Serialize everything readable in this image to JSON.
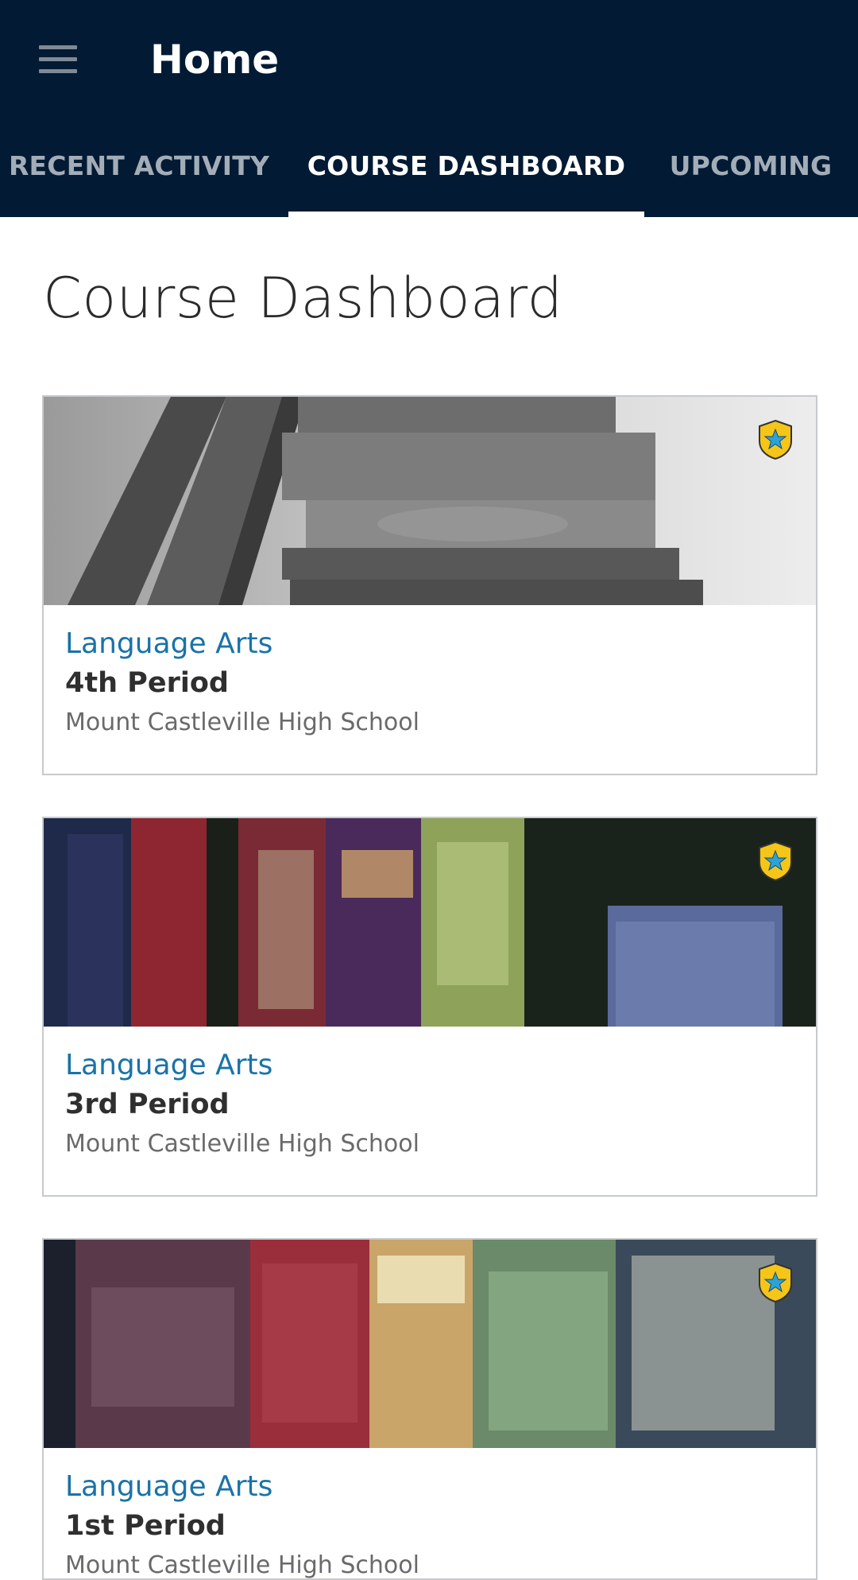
{
  "appbar": {
    "title": "Home",
    "menu_icon": "hamburger-menu-icon",
    "background": "#021a33"
  },
  "tabs": [
    {
      "label": "RECENT ACTIVITY",
      "active": false
    },
    {
      "label": "COURSE DASHBOARD",
      "active": true
    },
    {
      "label": "UPCOMING",
      "active": false
    }
  ],
  "page": {
    "heading": "Course Dashboard"
  },
  "courses": [
    {
      "title": "Language Arts",
      "period": "4th Period",
      "school": "Mount Castleville High School",
      "badge_icon": "star-shield-icon"
    },
    {
      "title": "Language Arts",
      "period": "3rd Period",
      "school": "Mount Castleville High School",
      "badge_icon": "star-shield-icon"
    },
    {
      "title": "Language Arts",
      "period": "1st Period",
      "school": "Mount Castleville High School",
      "badge_icon": "star-shield-icon"
    }
  ],
  "colors": {
    "link": "#1a73a8",
    "badge_fill": "#f5c518",
    "badge_star": "#2aa3d8"
  }
}
